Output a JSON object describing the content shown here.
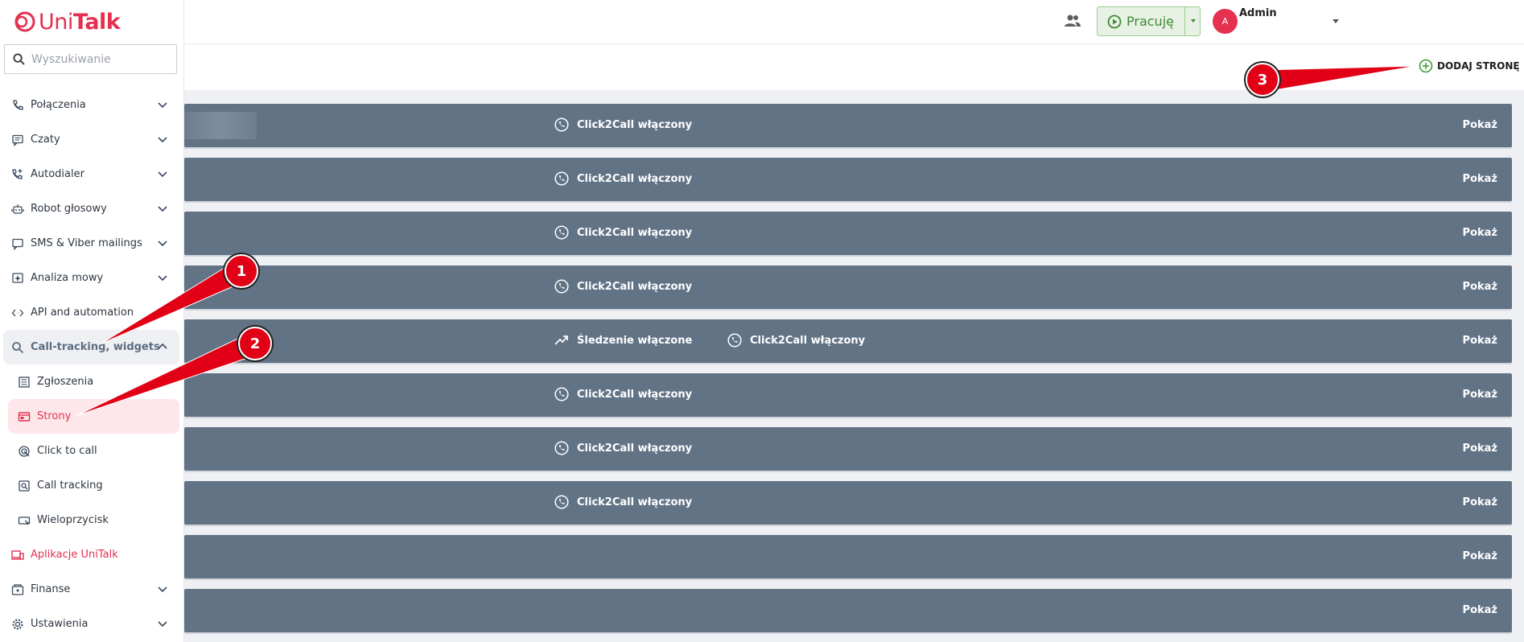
{
  "brand": {
    "logo_text_a": "Uni",
    "logo_text_b": "Talk",
    "color": "#e5304f"
  },
  "search": {
    "placeholder": "Wyszukiwanie"
  },
  "sidebar": {
    "items": [
      {
        "label": "Połączenia",
        "icon": "phone-icon",
        "chevron": "down"
      },
      {
        "label": "Czaty",
        "icon": "chat-icon",
        "chevron": "down"
      },
      {
        "label": "Autodialer",
        "icon": "phone-plus-icon",
        "chevron": "down"
      },
      {
        "label": "Robot głosowy",
        "icon": "robot-icon",
        "chevron": "down"
      },
      {
        "label": "SMS & Viber mailings",
        "icon": "message-icon",
        "chevron": "down"
      },
      {
        "label": "Analiza mowy",
        "icon": "speech-analysis-icon",
        "chevron": "down"
      },
      {
        "label": "API and automation",
        "icon": "code-icon",
        "chevron": "none"
      },
      {
        "label": "Call-tracking, widgets",
        "icon": "search-icon",
        "chevron": "up",
        "expanded": true
      },
      {
        "label": "Zgłoszenia",
        "icon": "list-icon",
        "sub": true
      },
      {
        "label": "Strony",
        "icon": "pages-icon",
        "sub": true,
        "active": true
      },
      {
        "label": "Click to call",
        "icon": "click-to-call-icon",
        "sub": true
      },
      {
        "label": "Call tracking",
        "icon": "call-tracking-icon",
        "sub": true
      },
      {
        "label": "Wieloprzycisk",
        "icon": "multibutton-icon",
        "sub": true
      },
      {
        "label": "Aplikacje UniTalk",
        "icon": "devices-icon",
        "app": true
      },
      {
        "label": "Finanse",
        "icon": "wallet-icon",
        "chevron": "down"
      },
      {
        "label": "Ustawienia",
        "icon": "gear-icon",
        "chevron": "down"
      }
    ]
  },
  "topbar": {
    "status_label": "Pracuję",
    "avatar_letter": "A",
    "user_name": "Admin"
  },
  "main": {
    "add_page_label": "DODAJ STRONĘ",
    "rows": [
      {
        "features": [
          "Click2Call włączony"
        ],
        "action": "Pokaż",
        "blurred_name": true
      },
      {
        "features": [
          "Click2Call włączony"
        ],
        "action": "Pokaż"
      },
      {
        "features": [
          "Click2Call włączony"
        ],
        "action": "Pokaż"
      },
      {
        "features": [
          "Click2Call włączony"
        ],
        "action": "Pokaż"
      },
      {
        "features": [
          "Śledzenie włączone",
          "Click2Call włączony"
        ],
        "action": "Pokaż"
      },
      {
        "features": [
          "Click2Call włączony"
        ],
        "action": "Pokaż"
      },
      {
        "features": [
          "Click2Call włączony"
        ],
        "action": "Pokaż"
      },
      {
        "features": [
          "Click2Call włączony"
        ],
        "action": "Pokaż"
      },
      {
        "features": [],
        "action": "Pokaż"
      },
      {
        "features": [],
        "action": "Pokaż"
      }
    ]
  },
  "annotations": [
    {
      "number": "1"
    },
    {
      "number": "2"
    },
    {
      "number": "3"
    }
  ],
  "colors": {
    "row_bg": "#627386",
    "accent": "#e5304f",
    "status_green": "#3f8a34",
    "annotation_red": "#e10015"
  }
}
